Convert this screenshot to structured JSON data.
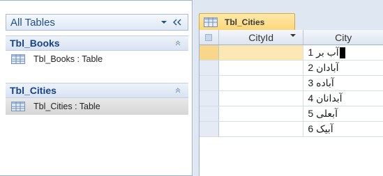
{
  "nav": {
    "header_label": "All Tables",
    "groups": [
      {
        "title": "Tbl_Books",
        "items": [
          {
            "label": "Tbl_Books : Table"
          }
        ]
      },
      {
        "title": "Tbl_Cities",
        "items": [
          {
            "label": "Tbl_Cities : Table"
          }
        ]
      }
    ]
  },
  "document": {
    "tab_label": "Tbl_Cities",
    "columns": [
      "CityId",
      "City"
    ],
    "rows": [
      {
        "city": "آب بر 1"
      },
      {
        "city": "آبادان 2"
      },
      {
        "city": "آباده 3"
      },
      {
        "city": "آبدانان 4"
      },
      {
        "city": "آبعلی 5"
      },
      {
        "city": "آبیک 6"
      }
    ]
  },
  "colors": {
    "accent": "#15428b",
    "tab": "#fcd779",
    "header": "#dfe8f5"
  }
}
